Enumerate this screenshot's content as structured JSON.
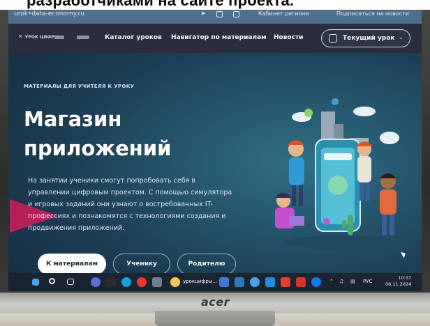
{
  "photo_caption": "разработчиками на сайте проекта.",
  "topbar": {
    "url": "urok•data-economy.ru",
    "cabinet_link": "Кабинет региона",
    "subscribe_link": "Подписаться на новости",
    "icons": [
      "telegram-icon",
      "vk-icon",
      "ok-icon"
    ]
  },
  "nav": {
    "logo": "УРОК ЦИФРЫ",
    "links": [
      "Каталог уроков",
      "Навигатор по материалам",
      "Новости"
    ],
    "current_lesson": "Текущий урок"
  },
  "hero": {
    "eyebrow": "МАТЕРИАЛЫ ДЛЯ УЧИТЕЛЯ К УРОКУ",
    "title_line1": "Магазин",
    "title_line2": "приложений",
    "description": "На занятии ученики смогут попробовать себя в управлении цифровым проектом. С помощью симулятора и игровых заданий они узнают о востребованных IT-профессиях и познакомятся с технологиями создания и продвижения приложений.",
    "buttons": [
      "К материалам",
      "Ученику",
      "Родителю"
    ]
  },
  "taskbar": {
    "app_label": "урокцифры...",
    "lang": "РУС",
    "time": "10:37",
    "date": "06.11.2024"
  },
  "monitor": {
    "brand": "acer"
  },
  "colors": {
    "hero_bg": "#1d3f55",
    "nav_bg": "#2a2e3c",
    "accent_pink": "#c81e5b",
    "topbar_bg": "#4d6f8e"
  }
}
